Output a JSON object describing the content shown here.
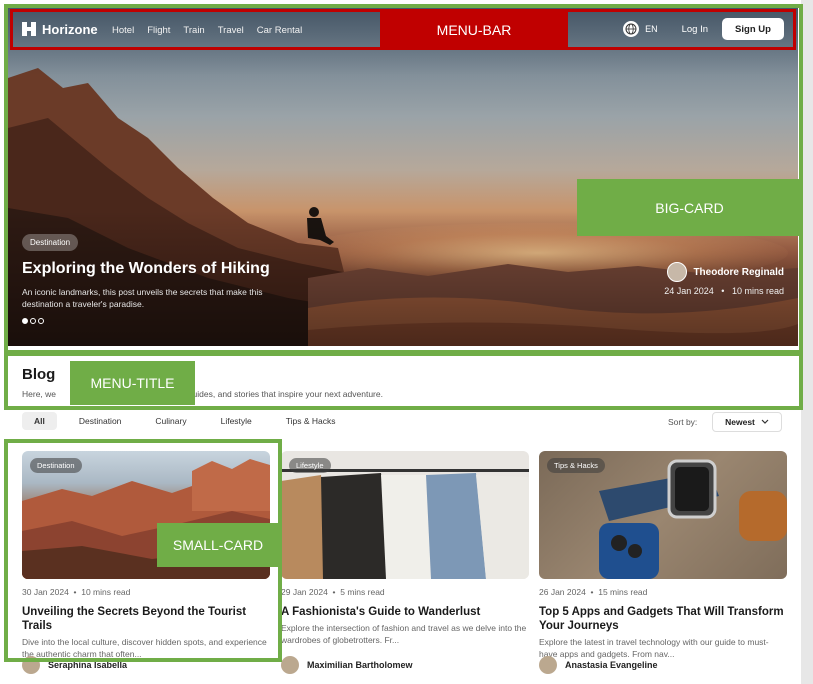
{
  "brand": {
    "name": "Horizone"
  },
  "nav": {
    "links": [
      "Hotel",
      "Flight",
      "Train",
      "Travel",
      "Car Rental"
    ],
    "lang": "EN",
    "login": "Log In",
    "signup": "Sign Up"
  },
  "hero": {
    "tag": "Destination",
    "title": "Exploring the Wonders of Hiking",
    "description": "An iconic landmarks, this post unveils the secrets that make this destination a traveler's paradise.",
    "author": "Theodore Reginald",
    "date": "24 Jan 2024",
    "read_time": "10 mins read"
  },
  "blog": {
    "title": "Blog",
    "subtitle_lead": "Here, we",
    "subtitle_tail": "on guides, and stories that inspire your next adventure."
  },
  "filters": {
    "chips": [
      "All",
      "Destination",
      "Culinary",
      "Lifestyle",
      "Tips & Hacks"
    ],
    "sort_label": "Sort by:",
    "sort_value": "Newest"
  },
  "cards": [
    {
      "tag": "Destination",
      "date": "30 Jan 2024",
      "read_time": "10 mins read",
      "title": "Unveiling the Secrets Beyond the Tourist Trails",
      "description": "Dive into the local culture, discover hidden spots, and experience the authentic charm that often...",
      "author": "Seraphina Isabella"
    },
    {
      "tag": "Lifestyle",
      "date": "29 Jan 2024",
      "read_time": "5 mins read",
      "title": "A Fashionista's Guide to Wanderlust",
      "description": "Explore the intersection of fashion and travel as we delve into the wardrobes of globetrotters. Fr...",
      "author": "Maximilian Bartholomew"
    },
    {
      "tag": "Tips & Hacks",
      "date": "26 Jan 2024",
      "read_time": "15 mins read",
      "title": "Top 5 Apps and Gadgets That Will Transform Your Journeys",
      "description": "Explore the latest in travel technology with our guide to must-have apps and gadgets. From nav...",
      "author": "Anastasia Evangeline"
    }
  ],
  "annotations": {
    "menu_bar": "MENU-BAR",
    "big_card": "BIG-CARD",
    "menu_title": "MENU-TITLE",
    "small_card": "SMALL-CARD"
  },
  "colors": {
    "annotation_green": "#70ad47",
    "annotation_red": "#c00000"
  }
}
